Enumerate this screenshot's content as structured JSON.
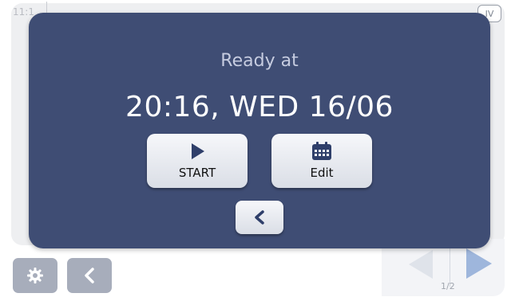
{
  "background": {
    "time": "11:1",
    "badge": "IV",
    "page_indicator": "1/2"
  },
  "modal": {
    "label": "Ready at",
    "datetime": "20:16, WED 16/06",
    "start_button": {
      "label": "START",
      "icon": "play-icon"
    },
    "edit_button": {
      "label": "Edit",
      "icon": "calendar-icon"
    },
    "back_button": {
      "icon": "chevron-left-icon"
    }
  },
  "bottom_bar": {
    "settings_icon": "gear-icon",
    "back_icon": "chevron-left-icon"
  },
  "colors": {
    "modal_background": "#3f4d74",
    "modal_label": "#c6cce0",
    "button_face": "#eceef3",
    "bottom_button": "#a7adbb",
    "next_arrow": "#9eb6dc"
  }
}
